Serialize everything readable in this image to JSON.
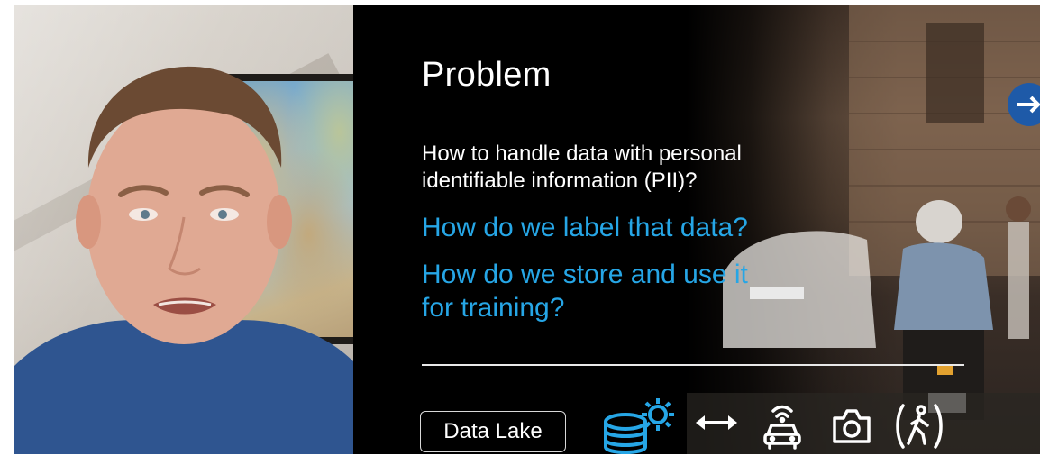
{
  "slide": {
    "title": "Problem",
    "question": "How to handle data with personal identifiable information (PII)?",
    "highlights": [
      "How do we label that data?",
      "How do we store and use it",
      "for training?"
    ],
    "data_lake_label": "Data Lake",
    "icons": [
      "database-gear-icon",
      "double-arrow-icon",
      "connected-car-icon",
      "camera-icon",
      "pedestrian-icon"
    ]
  },
  "colors": {
    "accent": "#26a6e6",
    "slide_background": "#000000",
    "text": "#ffffff"
  }
}
